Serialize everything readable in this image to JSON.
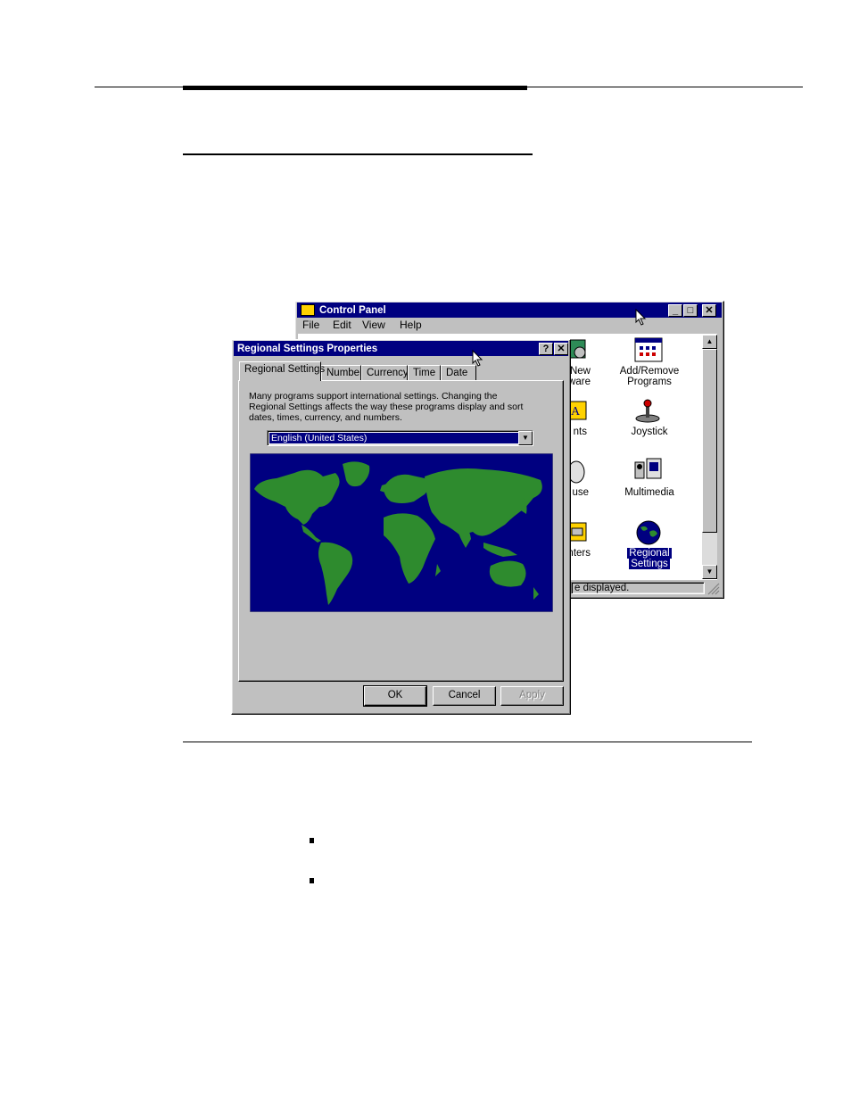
{
  "control_panel": {
    "title": "Control Panel",
    "menu": [
      "File",
      "Edit",
      "View",
      "Help"
    ],
    "items": [
      {
        "label": "New",
        "label2": "dware"
      },
      {
        "label": "Add/Remove",
        "label2": "Programs"
      },
      {
        "label": "nts",
        "label2": ""
      },
      {
        "label": "Joystick",
        "label2": ""
      },
      {
        "label": "use",
        "label2": ""
      },
      {
        "label": "Multimedia",
        "label2": ""
      },
      {
        "label": "nters",
        "label2": ""
      },
      {
        "label": "Regional",
        "label2": "Settings"
      }
    ],
    "status": "e displayed."
  },
  "dialog": {
    "title": "Regional Settings Properties",
    "tabs": [
      "Regional Settings",
      "Number",
      "Currency",
      "Time",
      "Date"
    ],
    "description": "Many programs support international settings. Changing the Regional Settings affects the way these programs display and sort dates, times, currency, and numbers.",
    "locale": "English (United States)",
    "buttons": {
      "ok": "OK",
      "cancel": "Cancel",
      "apply": "Apply"
    }
  },
  "colors": {
    "title_bar": "#000080",
    "face": "#c0c0c0",
    "map_ocean": "#000080",
    "map_land": "#2e8b2e"
  },
  "icons": [
    "help-icon",
    "close-icon",
    "minimize-icon",
    "maximize-icon",
    "control-panel-icon",
    "mouse-cursor-icon",
    "globe-icon",
    "joystick-icon",
    "multimedia-icon",
    "add-remove-programs-icon",
    "bullet-icon"
  ]
}
